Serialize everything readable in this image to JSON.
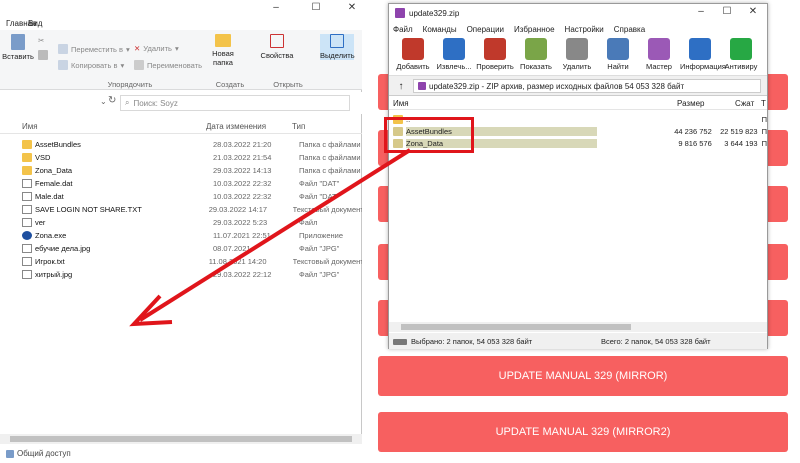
{
  "explorer": {
    "tabs": [
      "Главная",
      "Вид"
    ],
    "ribbon": {
      "pin_label": "Закрепить на панели быстрого доступа",
      "copy_label": "Копировать",
      "paste_label": "Вставить",
      "move_to": "Переместить в",
      "copy_to": "Копировать в",
      "delete": "Удалить",
      "rename": "Переименовать",
      "new_folder": "Новая папка",
      "properties": "Свойства",
      "select": "Выделить",
      "group_organize": "Упорядочить",
      "group_create": "Создать",
      "group_open": "Открыть"
    },
    "search_placeholder": "Поиск: Soyz",
    "columns": {
      "name": "Имя",
      "date": "Дата изменения",
      "type": "Тип"
    },
    "files": [
      {
        "name": "AssetBundles",
        "date": "28.03.2022 21:20",
        "type": "Папка с файлами",
        "kind": "folder"
      },
      {
        "name": "VSD",
        "date": "21.03.2022 21:54",
        "type": "Папка с файлами",
        "kind": "folder"
      },
      {
        "name": "Zona_Data",
        "date": "29.03.2022 14:13",
        "type": "Папка с файлами",
        "kind": "folder"
      },
      {
        "name": "Female.dat",
        "date": "10.03.2022 22:32",
        "type": "Файл \"DAT\"",
        "kind": "file"
      },
      {
        "name": "Male.dat",
        "date": "10.03.2022 22:32",
        "type": "Файл \"DAT\"",
        "kind": "file"
      },
      {
        "name": "SAVE LOGIN NOT SHARE.TXT",
        "date": "29.03.2022 14:17",
        "type": "Текстовый документ",
        "kind": "file"
      },
      {
        "name": "ver",
        "date": "29.03.2022 5:23",
        "type": "Файл",
        "kind": "file"
      },
      {
        "name": "Zona.exe",
        "date": "11.07.2021 22:51",
        "type": "Приложение",
        "kind": "exe"
      },
      {
        "name": "ебучие дела.jpg",
        "date": "08.07.2021",
        "type": "Файл \"JPG\"",
        "kind": "img"
      },
      {
        "name": "Игрок.txt",
        "date": "11.08.2021 14:20",
        "type": "Текстовый документ",
        "kind": "file"
      },
      {
        "name": "хитрый.jpg",
        "date": "29.03.2022 22:12",
        "type": "Файл \"JPG\"",
        "kind": "img"
      }
    ],
    "status": "Общий доступ"
  },
  "winrar": {
    "title": "update329.zip",
    "menu": [
      "Файл",
      "Команды",
      "Операции",
      "Избранное",
      "Настройки",
      "Справка"
    ],
    "toolbar": [
      {
        "label": "Добавить",
        "color": "#c0392b"
      },
      {
        "label": "Извлечь...",
        "color": "#2e6fc4"
      },
      {
        "label": "Проверить",
        "color": "#c0392b"
      },
      {
        "label": "Показать",
        "color": "#7aa548"
      },
      {
        "label": "Удалить",
        "color": "#888888"
      },
      {
        "label": "Найти",
        "color": "#4a7ab8"
      },
      {
        "label": "Мастер",
        "color": "#9b59b6"
      },
      {
        "label": "Информация",
        "color": "#2e6fc4"
      },
      {
        "label": "Антивиру",
        "color": "#27a844"
      }
    ],
    "path": "update329.zip - ZIP архив, размер исходных файлов 54 053 328 байт",
    "columns": {
      "name": "Имя",
      "size": "Размер",
      "packed": "Сжат",
      "t": "Т"
    },
    "rows": [
      {
        "name": "..",
        "size": "",
        "packed": "",
        "t": "П"
      },
      {
        "name": "AssetBundles",
        "size": "44 236 752",
        "packed": "22 519 823",
        "t": "П"
      },
      {
        "name": "Zona_Data",
        "size": "9 816 576",
        "packed": "3 644 193",
        "t": "П"
      }
    ],
    "status_left": "Выбрано: 2 папок, 54 053 328 байт",
    "status_right": "Всего: 2 папок, 54 053 328 байт"
  },
  "webpage": {
    "buttons": [
      "UPDATE MANUAL 329 (MIRROR)",
      "UPDATE MANUAL 329 (MIRROR2)"
    ],
    "accent": "#f76060"
  },
  "annotation_color": "#e0151b"
}
